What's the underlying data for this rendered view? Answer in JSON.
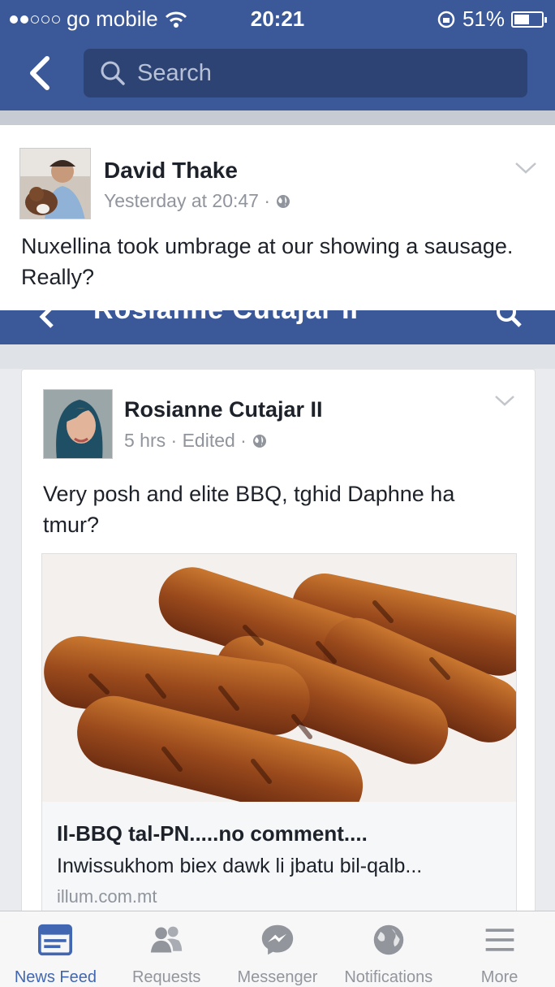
{
  "status_bar": {
    "carrier": "go mobile",
    "time": "20:21",
    "battery": "51%"
  },
  "nav": {
    "search_placeholder": "Search"
  },
  "post1": {
    "author": "David Thake",
    "meta": "Yesterday at 20:47 ·",
    "text": "Nuxellina took umbrage at our showing a sausage. Really?"
  },
  "behind_header": {
    "title": "Rosianne Cutajar II"
  },
  "post2": {
    "author": "Rosianne Cutajar II",
    "meta": "5 hrs · Edited ·",
    "text": "Very posh and elite BBQ, tghid Daphne ha tmur?",
    "link": {
      "title": "Il-BBQ tal-PN.....no comment....",
      "description": "Inwissukhom biex dawk li jbatu bil-qalb...",
      "domain": "illum.com.mt"
    }
  },
  "tabs": [
    {
      "label": "News Feed",
      "icon": "news-feed-icon",
      "active": true
    },
    {
      "label": "Requests",
      "icon": "requests-icon",
      "active": false
    },
    {
      "label": "Messenger",
      "icon": "messenger-icon",
      "active": false
    },
    {
      "label": "Notifications",
      "icon": "globe-icon",
      "active": false
    },
    {
      "label": "More",
      "icon": "menu-icon",
      "active": false
    }
  ],
  "colors": {
    "brand": "#3b5998",
    "active_tab": "#4267b2",
    "text": "#1d2129",
    "muted": "#90949c"
  }
}
